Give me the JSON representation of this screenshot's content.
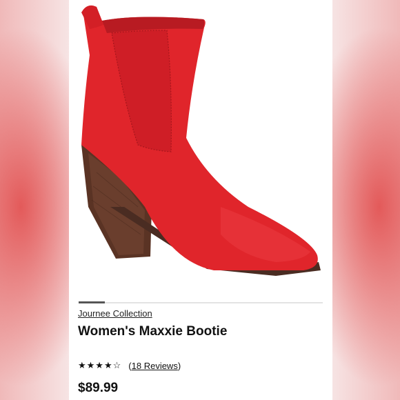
{
  "product": {
    "brand": "Journee Collection",
    "title": "Women's Maxxie Bootie",
    "rating_stars": "★★★★☆",
    "rating_value": 4.5,
    "reviews_open": "(",
    "reviews_link": "18 Reviews",
    "reviews_close": ")",
    "price": "$89.99"
  },
  "colors": {
    "boot": "#e0252b",
    "heel": "#5a3324",
    "accent_bg": "#e35a5a"
  },
  "icons": {
    "rating": "star-icon"
  }
}
